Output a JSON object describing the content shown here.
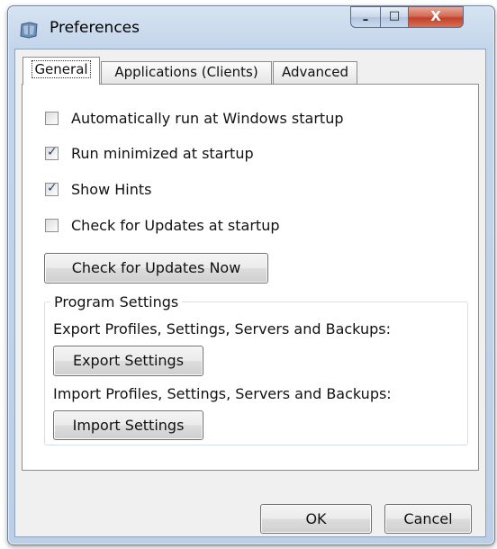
{
  "window": {
    "title": "Preferences",
    "minimize": "–",
    "maximize": "□",
    "close": "X"
  },
  "tabs": [
    {
      "label": "General",
      "active": true
    },
    {
      "label": "Applications (Clients)",
      "active": false
    },
    {
      "label": "Advanced",
      "active": false
    }
  ],
  "general": {
    "checkboxes": [
      {
        "label": "Automatically run at Windows startup",
        "checked": false
      },
      {
        "label": "Run minimized at startup",
        "checked": true
      },
      {
        "label": "Show Hints",
        "checked": true
      },
      {
        "label": "Check for Updates at startup",
        "checked": false
      }
    ],
    "check_updates_button": "Check for Updates Now",
    "program_settings": {
      "title": "Program Settings",
      "export_text": "Export Profiles, Settings, Servers and Backups:",
      "export_button": "Export Settings",
      "import_text": "Import Profiles, Settings, Servers and Backups:",
      "import_button": "Import Settings"
    }
  },
  "footer": {
    "ok": "OK",
    "cancel": "Cancel"
  },
  "check_glyph": "✓",
  "colors": {
    "title_bar": "#c3d5ea",
    "close_button": "#c2412a",
    "check_tick": "#2a3f73"
  }
}
